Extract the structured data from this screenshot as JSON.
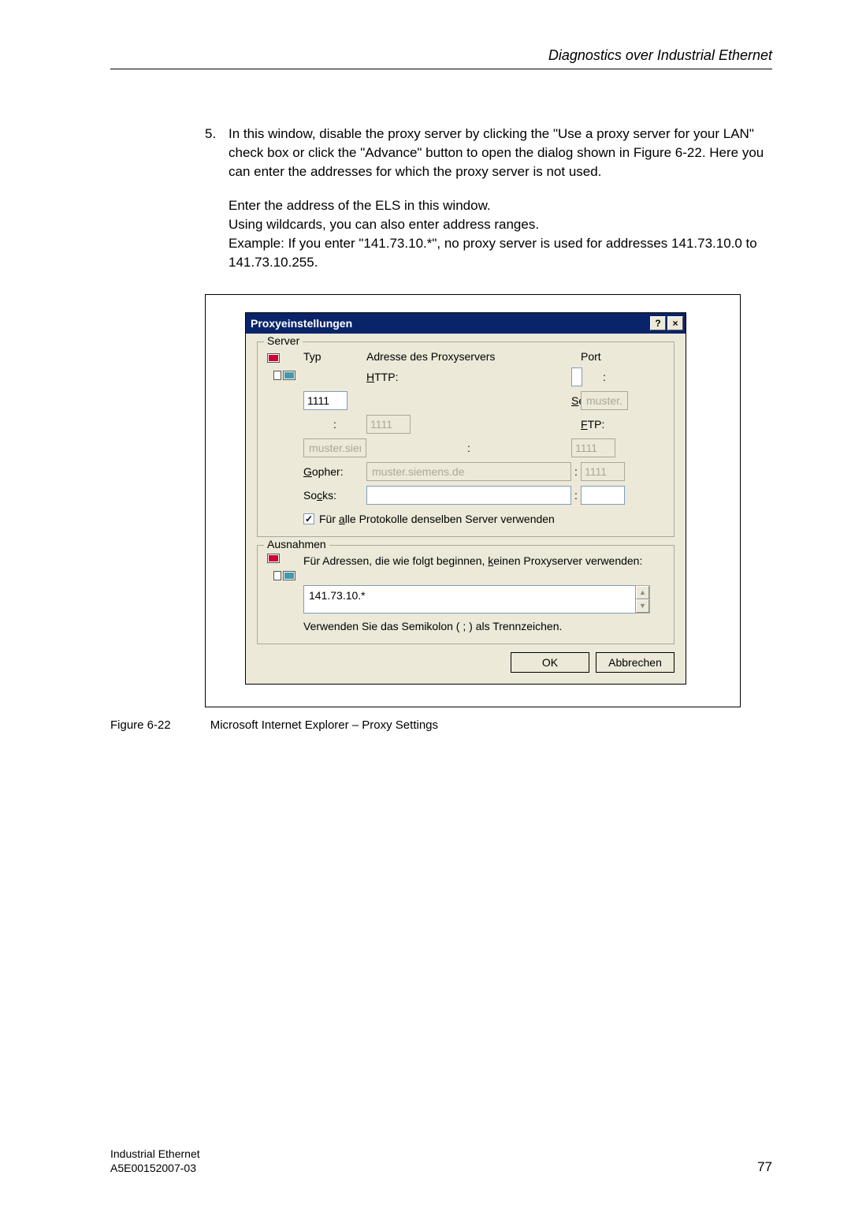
{
  "header": {
    "title": "Diagnostics over Industrial Ethernet"
  },
  "body": {
    "step_num": "5.",
    "step_text": "In this window, disable the proxy server by clicking the \"Use a proxy server for your LAN\" check box or click the \"Advance\" button to open the dialog shown in Figure 6-22. Here you can enter the addresses for which the proxy server is not used.",
    "para2_l1": "Enter the address of the ELS in this window.",
    "para2_l2": "Using wildcards, you can also enter address ranges.",
    "para2_l3": "Example: If you enter \"141.73.10.*\", no proxy server is used for addresses 141.73.10.0 to 141.73.10.255."
  },
  "dialog": {
    "title": "Proxyeinstellungen",
    "help": "?",
    "close": "×",
    "server_group": "Server",
    "typ_hdr": "Typ",
    "addr_hdr": "Adresse des Proxyservers",
    "port_hdr": "Port",
    "rows": {
      "http": {
        "label_pre": "H",
        "label_rest": "TTP:",
        "addr": "muster.siemens.de",
        "port": "1111"
      },
      "secure": {
        "label_pre": "S",
        "label_rest": "ecure:",
        "addr": "muster.siemens.de",
        "port": "1111"
      },
      "ftp": {
        "label_pre": "F",
        "label_rest": "TP:",
        "addr": "muster.siemens.de",
        "port": "1111"
      },
      "gopher": {
        "label_pre": "G",
        "label_rest": "opher:",
        "addr": "muster.siemens.de",
        "port": "1111"
      },
      "socks": {
        "label_pre": "c",
        "label_full": "Socks:",
        "addr": "",
        "port": ""
      }
    },
    "checkbox_label_pre": "Für ",
    "checkbox_label_u": "a",
    "checkbox_label_post": "lle Protokolle denselben Server verwenden",
    "checkmark": "✓",
    "exc_group": "Ausnahmen",
    "exc_text_pre": "Für Adressen, die wie folgt beginnen, ",
    "exc_text_u": "k",
    "exc_text_post": "einen Proxyserver verwenden:",
    "exc_value": "141.73.10.*",
    "hint2": "Verwenden Sie das Semikolon ( ; ) als Trennzeichen.",
    "ok": "OK",
    "cancel": "Abbrechen"
  },
  "caption": {
    "fig": "Figure 6-22",
    "text": "Microsoft Internet Explorer – Proxy Settings"
  },
  "footer": {
    "line1": "Industrial Ethernet",
    "line2": "A5E00152007-03",
    "page": "77"
  }
}
